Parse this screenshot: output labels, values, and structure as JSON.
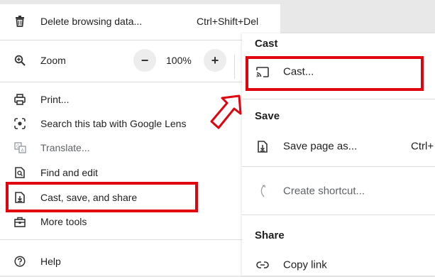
{
  "main_menu": {
    "delete_browsing": {
      "label": "Delete browsing data...",
      "shortcut": "Ctrl+Shift+Del",
      "icon": "trash-icon"
    },
    "zoom": {
      "label": "Zoom",
      "minus": "−",
      "value": "100%",
      "plus": "+",
      "icon": "zoom-icon"
    },
    "print": {
      "label": "Print...",
      "icon": "print-icon"
    },
    "lens": {
      "label": "Search this tab with Google Lens",
      "icon": "lens-icon"
    },
    "translate": {
      "label": "Translate...",
      "icon": "translate-icon"
    },
    "find_edit": {
      "label": "Find and edit",
      "icon": "find-icon"
    },
    "cast_save_share": {
      "label": "Cast, save, and share",
      "icon": "cast-save-share-icon"
    },
    "more_tools": {
      "label": "More tools",
      "icon": "toolbox-icon"
    },
    "help": {
      "label": "Help",
      "icon": "help-icon"
    }
  },
  "sub_menu": {
    "cast_heading": "Cast",
    "cast": {
      "label": "Cast...",
      "icon": "cast-icon"
    },
    "save_heading": "Save",
    "save_page": {
      "label": "Save page as...",
      "shortcut": "Ctrl+",
      "icon": "save-page-icon"
    },
    "create_shortcut": {
      "label": "Create shortcut...",
      "icon": "shortcut-icon"
    },
    "share_heading": "Share",
    "copy_link": {
      "label": "Copy link",
      "icon": "link-icon"
    }
  },
  "colors": {
    "highlight": "#e0040e",
    "menu_bg": "#ffffff",
    "text": "#1f1f1f",
    "disabled_text": "#5f6368"
  }
}
